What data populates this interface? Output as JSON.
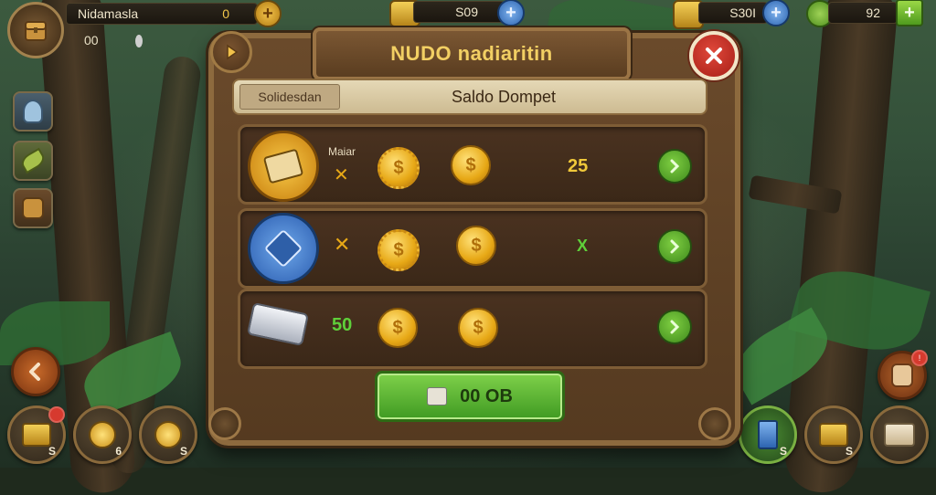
{
  "hud": {
    "player_name": "Nidamasla",
    "player_value": "0",
    "extra_left": "00",
    "resource1_value": "S09",
    "resource2_value": "S30I",
    "resource3_value": "92"
  },
  "panel": {
    "title": "NUDO nadiaritin",
    "tab_left_label": "Solidesdan",
    "tab_title": "Saldo Dompet",
    "rows": [
      {
        "label": "Maiar",
        "amount": "25",
        "amount_color": "#f0c83a"
      },
      {
        "label": "",
        "amount": "X",
        "amount_color": "#5fcf3a"
      },
      {
        "label": "50",
        "amount": "",
        "amount_color": "#5fcf3a"
      }
    ],
    "main_button_label": "00 OB",
    "icons": {
      "play": "play-icon",
      "close": "close-icon",
      "go": "chevron-right-icon"
    }
  },
  "bottom_left": {
    "items": [
      {
        "count": "S"
      },
      {
        "count": "6"
      },
      {
        "count": "S"
      }
    ]
  },
  "bottom_right": {
    "items": [
      {
        "count": "S"
      },
      {
        "count": "S"
      },
      {
        "count": ""
      }
    ]
  },
  "colors": {
    "panel_brown": "#553a20",
    "title_gold": "#f2cf63",
    "green_button": "#5fb42c",
    "close_red": "#c92a22"
  }
}
